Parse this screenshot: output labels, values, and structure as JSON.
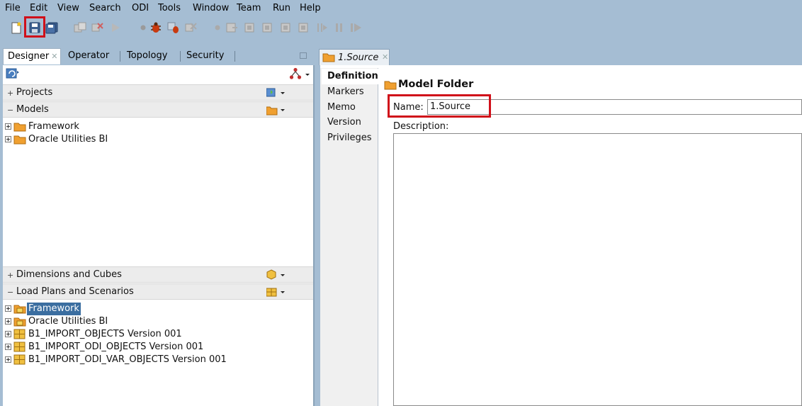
{
  "menu": [
    "File",
    "Edit",
    "View",
    "Search",
    "ODI",
    "Tools",
    "Window",
    "Team",
    "Run",
    "Help"
  ],
  "toolbar": {
    "icons": [
      "new-icon",
      "save-icon",
      "save-all-icon",
      "run-icon",
      "debug-icon",
      "stop-icon"
    ]
  },
  "navigator": {
    "tabs": [
      "Designer",
      "Operator",
      "Topology",
      "Security"
    ],
    "sections": {
      "projects": "Projects",
      "models": "Models",
      "dimensions": "Dimensions and Cubes",
      "load_plans": "Load Plans and Scenarios"
    },
    "models_tree": [
      "Framework",
      "Oracle Utilities BI"
    ],
    "load_plans_tree": [
      "Framework",
      "Oracle Utilities BI",
      "B1_IMPORT_OBJECTS Version 001",
      "B1_IMPORT_ODI_OBJECTS Version 001",
      "B1_IMPORT_ODI_VAR_OBJECTS Version 001"
    ]
  },
  "editor": {
    "tab_label": "1.Source",
    "vertical_tabs": [
      "Definition",
      "Markers",
      "Memo",
      "Version",
      "Privileges"
    ],
    "section_title": "Model Folder",
    "name_label": "Name:",
    "name_value": "1.Source",
    "description_label": "Description:"
  },
  "colors": {
    "highlight": "#d0101a",
    "folder": "#f0a030",
    "selected_row": "#3b6ea0"
  }
}
